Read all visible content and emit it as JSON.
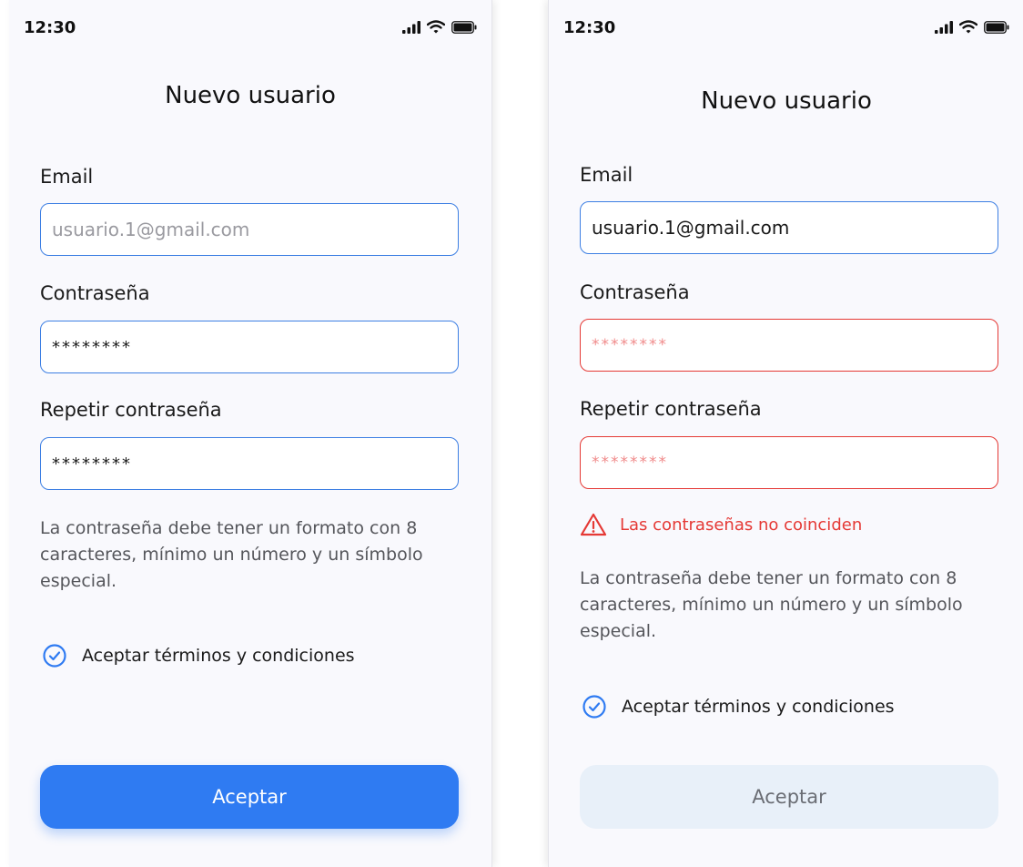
{
  "colors": {
    "accent": "#2f7bf2",
    "input_border": "#3d7fe3",
    "error": "#e53935",
    "disabled_button_bg": "#e8f0f9"
  },
  "screens": [
    {
      "status_time": "12:30",
      "title": "Nuevo usuario",
      "email_label": "Email",
      "email_placeholder": "usuario.1@gmail.com",
      "password_label": "Contraseña",
      "password_value": "********",
      "repeat_label": "Repetir contraseña",
      "repeat_value": "********",
      "help_text": "La contraseña debe tener un formato con 8 caracteres, mínimo un número y un símbolo especial.",
      "terms_label": "Aceptar términos y condiciones",
      "terms_icon": "check-circle-icon",
      "button_label": "Aceptar"
    },
    {
      "status_time": "12:30",
      "title": "Nuevo usuario",
      "email_label": "Email",
      "email_value": "usuario.1@gmail.com",
      "password_label": "Contraseña",
      "password_value": "********",
      "repeat_label": "Repetir contraseña",
      "repeat_value": "********",
      "error_icon": "warning-icon",
      "error_message": "Las contraseñas no coinciden",
      "help_text": "La contraseña debe tener un formato con 8 caracteres, mínimo un número y un símbolo especial.",
      "terms_label": "Aceptar términos y condiciones",
      "terms_icon": "check-circle-icon",
      "button_label": "Aceptar"
    }
  ]
}
